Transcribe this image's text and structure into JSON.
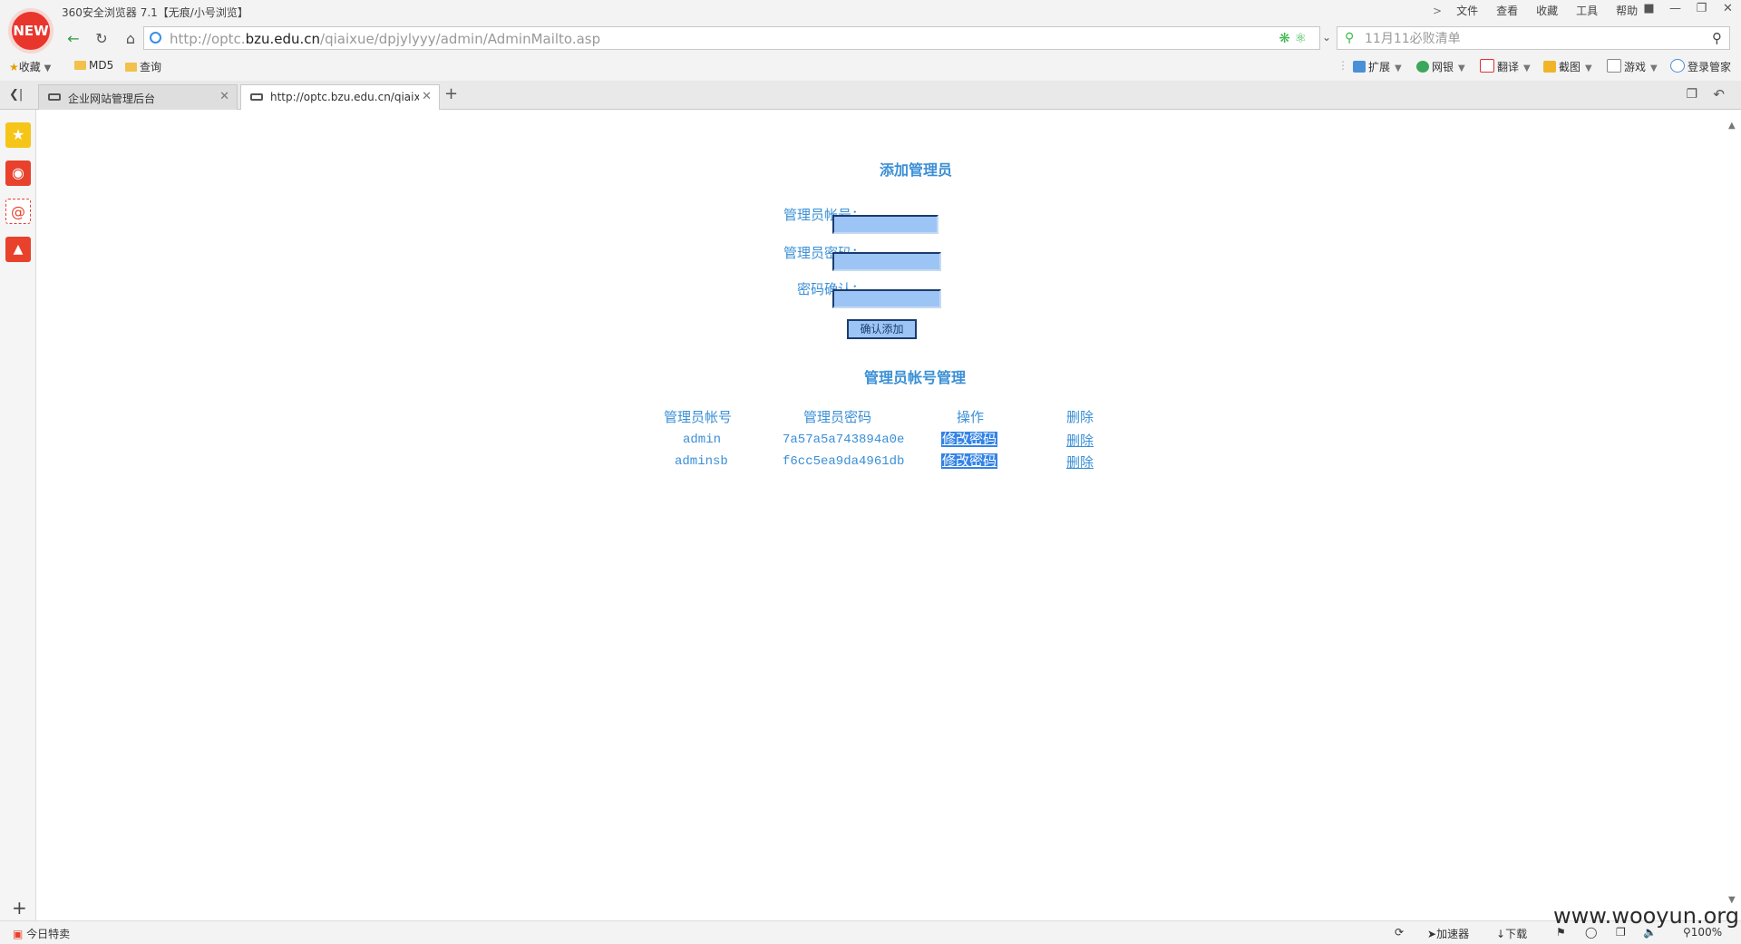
{
  "browser": {
    "logo_text": "NEW",
    "title": "360安全浏览器 7.1【无痕/小号浏览】",
    "menu_chevron": ">",
    "menu": [
      "文件",
      "查看",
      "收藏",
      "工具",
      "帮助"
    ],
    "url_scheme_host_pre": "http://optc.",
    "url_domain": "bzu.edu.cn",
    "url_path": "/qiaixue/dpjylyyy/admin/AdminMailto.asp",
    "search_placeholder": "11月11必败清单",
    "bookmarks": {
      "favorites": "收藏",
      "folder1": "MD5",
      "folder2": "查询"
    },
    "tools": {
      "extend": "扩展",
      "bank": "网银",
      "translate": "翻译",
      "screenshot": "截图",
      "games": "游戏",
      "login": "登录管家"
    },
    "tabs": [
      {
        "label": "企业网站管理后台",
        "active": false
      },
      {
        "label": "http://optc.bzu.edu.cn/qiaixue",
        "active": true
      }
    ],
    "status": {
      "today_deals": "今日特卖",
      "accelerator": "加速器",
      "download": "下载",
      "zoom": "100%"
    },
    "watermark": "www.wooyun.org"
  },
  "page": {
    "add_title": "添加管理员",
    "form": {
      "account_label": "管理员帐号：",
      "password_label": "管理员密码：",
      "confirm_label": "密码确认：",
      "account_value": "",
      "password_value": "",
      "confirm_value": "",
      "submit_label": "确认添加"
    },
    "manage_title": "管理员帐号管理",
    "table": {
      "headers": [
        "管理员帐号",
        "管理员密码",
        "操作",
        "删除"
      ],
      "rows": [
        {
          "account": "admin",
          "password": "7a57a5a743894a0e",
          "action": "修改密码",
          "delete": "删除"
        },
        {
          "account": "adminsb",
          "password": "f6cc5ea9da4961db",
          "action": "修改密码",
          "delete": "删除"
        }
      ]
    }
  },
  "colors": {
    "accent_text": "#3a8fd6",
    "input_fill": "#9cc5f5",
    "selection": "#3383e6"
  }
}
